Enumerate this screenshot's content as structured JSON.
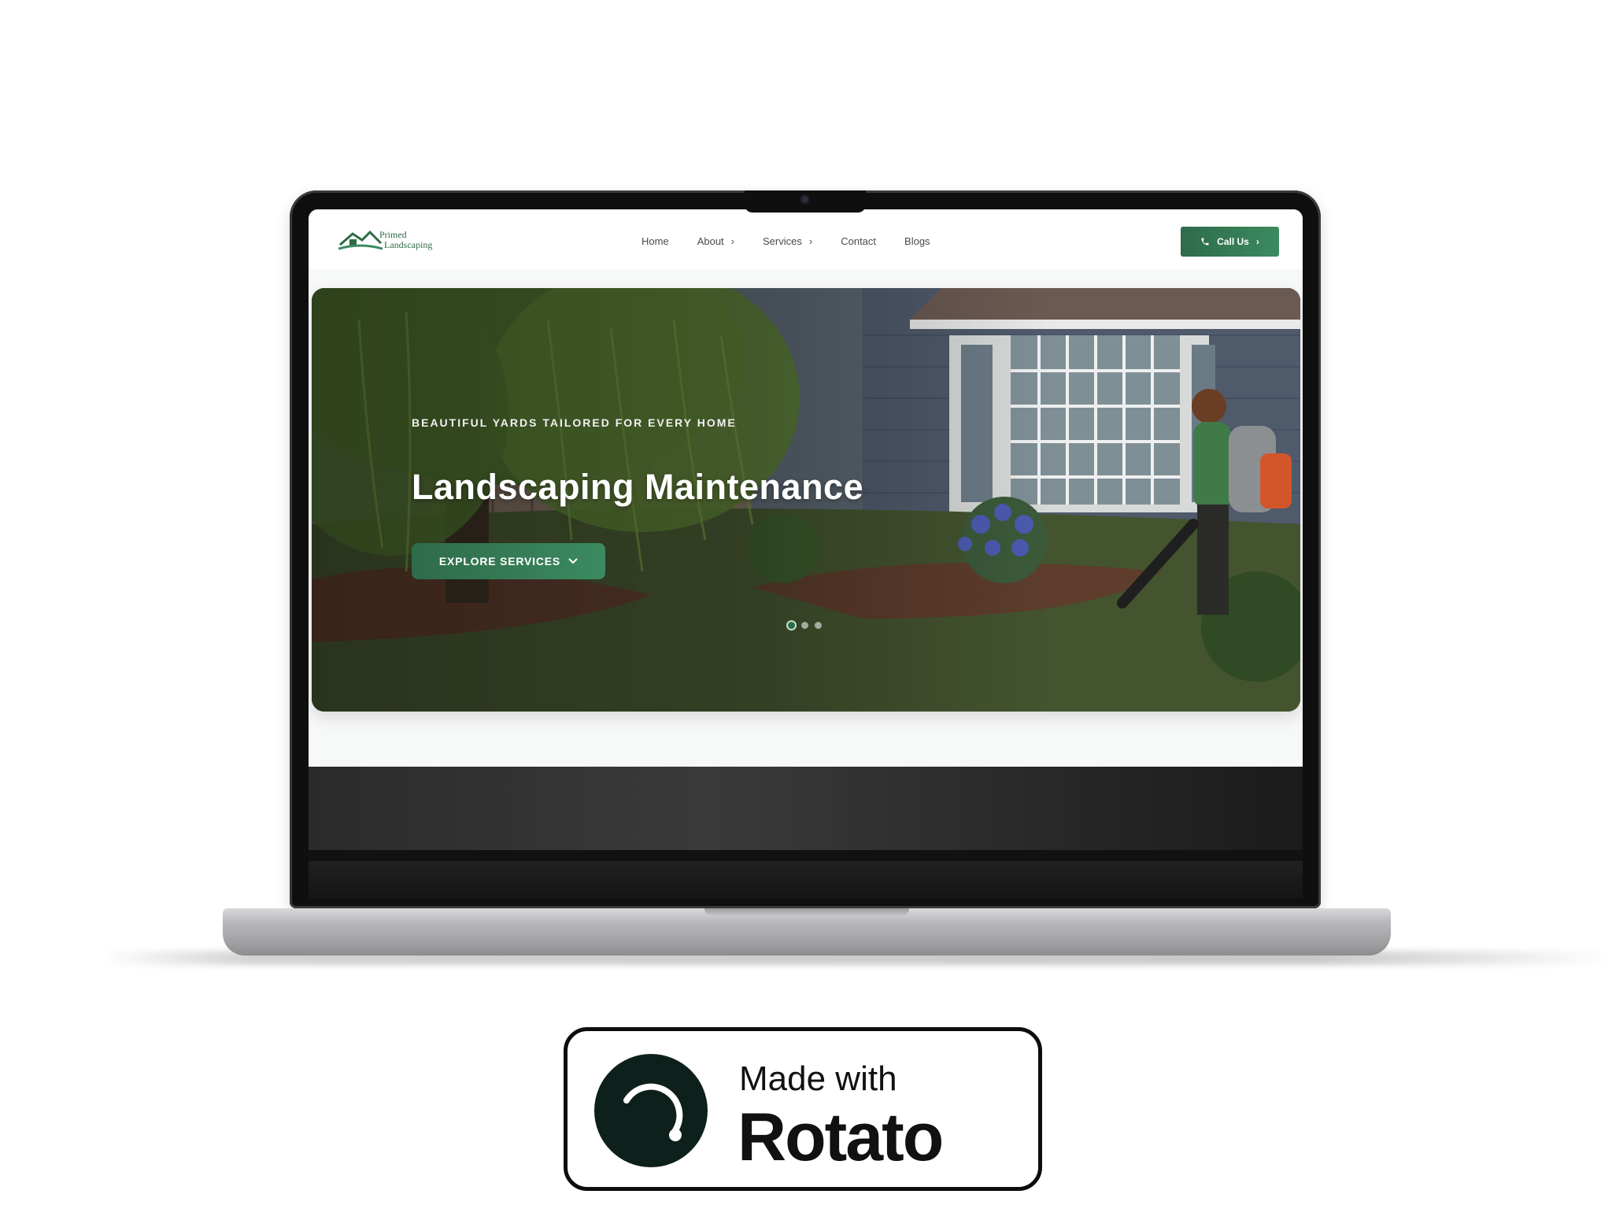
{
  "site": {
    "logo": {
      "line1": "Primed",
      "line2": "Landscaping"
    },
    "nav": [
      {
        "label": "Home",
        "has_dropdown": false
      },
      {
        "label": "About",
        "has_dropdown": true
      },
      {
        "label": "Services",
        "has_dropdown": true
      },
      {
        "label": "Contact",
        "has_dropdown": false
      },
      {
        "label": "Blogs",
        "has_dropdown": false
      }
    ],
    "call_button": {
      "label": "Call Us",
      "icon": "phone-icon"
    },
    "hero": {
      "eyebrow": "BEAUTIFUL YARDS TAILORED FOR EVERY HOME",
      "title": "Landscaping Maintenance",
      "cta": {
        "label": "EXPLORE SERVICES",
        "icon": "chevron-down-icon"
      },
      "slider": {
        "total": 3,
        "active_index": 0
      }
    },
    "colors": {
      "brand_green": "#2e6b4a",
      "brand_green_light": "#3c8a60"
    }
  },
  "badge": {
    "line1": "Made with",
    "line2": "Rotato"
  }
}
